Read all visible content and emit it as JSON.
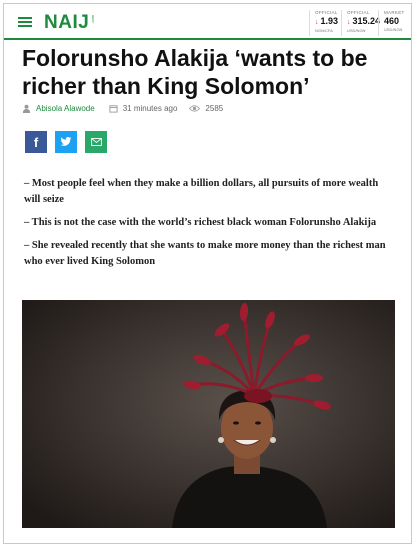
{
  "header": {
    "logo_text": "NAIJ",
    "logo_suffix": ".com",
    "brand_color": "#1e8a3e",
    "tickers": [
      {
        "label": "OFFICIAL",
        "value": "1.93",
        "unit": "NGN/CFA",
        "trend": "down"
      },
      {
        "label": "OFFICIAL",
        "value": "315.24",
        "unit": "USD/NGN",
        "trend": "down"
      },
      {
        "label": "MARKET",
        "value": "460",
        "unit": "USD/NGN",
        "trend": "none"
      }
    ]
  },
  "article": {
    "title": "Folorunsho Alakija ‘wants to be richer than King Solomon’",
    "author": "Abisola Alawode",
    "time": "31 minutes ago",
    "views": "2585",
    "bullets": [
      "– Most people feel when they make a billion dollars, all pursuits of more wealth will seize",
      "– This is not the case with the world’s richest black woman Folorunsho Alakija",
      "– She revealed recently that she wants to make more money than the richest man who ever lived King Solomon"
    ]
  },
  "share": {
    "facebook_icon": "f",
    "twitter_icon": "twitter-bird",
    "email_icon": "envelope"
  }
}
